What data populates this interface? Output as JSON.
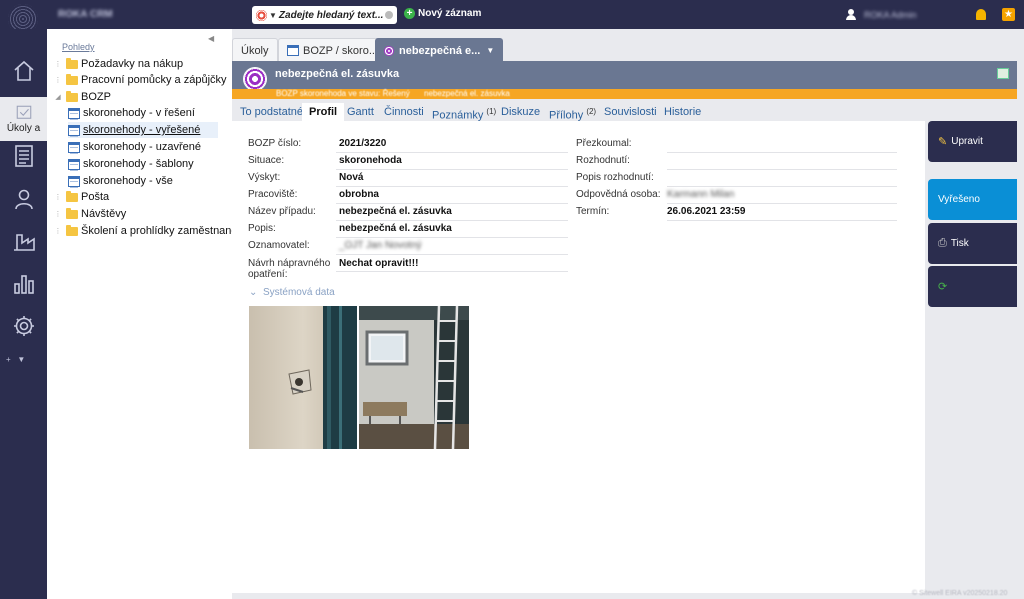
{
  "app": {
    "title": "ROKA CRM"
  },
  "topbar": {
    "search_placeholder": "Zadejte hledaný text...",
    "new_record": "Nový záznam",
    "user_name": "ROKA Admin"
  },
  "rail": {
    "tasks_label": "Úkoly a",
    "icons": [
      "home-icon",
      "tasks-icon",
      "document-icon",
      "user-icon",
      "factory-icon",
      "chart-icon",
      "gear-icon"
    ]
  },
  "tree": {
    "heading": "Pohledy",
    "items": [
      {
        "label": "Požadavky na nákup"
      },
      {
        "label": "Pracovní pomůcky a zápůjčky"
      },
      {
        "label": "BOZP"
      },
      {
        "label": "skoronehody - v řešení"
      },
      {
        "label": "skoronehody - vyřešené"
      },
      {
        "label": "skoronehody - uzavřené"
      },
      {
        "label": "skoronehody - šablony"
      },
      {
        "label": "skoronehody - vše"
      },
      {
        "label": "Pošta"
      },
      {
        "label": "Návštěvy"
      },
      {
        "label": "Školení a prohlídky zaměstnanců"
      }
    ]
  },
  "tabs": [
    {
      "label": "Úkoly"
    },
    {
      "label": "BOZP / skoro..."
    },
    {
      "label": "nebezpečná e..."
    }
  ],
  "record": {
    "title": "nebezpečná el. zásuvka",
    "status_left": "BOZP skoronehoda ve stavu: Řešený",
    "status_right": "nebezpečná el. zásuvka"
  },
  "subtabs": [
    {
      "label": "To podstatné"
    },
    {
      "label": "Profil"
    },
    {
      "label": "Gantt"
    },
    {
      "label": "Činnosti"
    },
    {
      "label": "Poznámky",
      "count": "(1)"
    },
    {
      "label": "Diskuze"
    },
    {
      "label": "Přílohy",
      "count": "(2)"
    },
    {
      "label": "Souvislosti"
    },
    {
      "label": "Historie"
    }
  ],
  "fields_left": [
    {
      "label": "BOZP číslo:",
      "value": "2021/3220"
    },
    {
      "label": "Situace:",
      "value": "skoronehoda"
    },
    {
      "label": "Výskyt:",
      "value": "Nová"
    },
    {
      "label": "Pracoviště:",
      "value": "obrobna"
    },
    {
      "label": "Název případu:",
      "value": "nebezpečná el. zásuvka"
    },
    {
      "label": "Popis:",
      "value": "nebezpečná el. zásuvka"
    },
    {
      "label": "Oznamovatel:",
      "value": "_OJT Jan Novotný"
    },
    {
      "label_line1": "Návrh nápravného",
      "label_line2": "opatření:",
      "value": "Nechat opravit!!!"
    }
  ],
  "fields_right": [
    {
      "label": "Přezkoumal:",
      "value": ""
    },
    {
      "label": "Rozhodnutí:",
      "value": ""
    },
    {
      "label": "Popis rozhodnutí:",
      "value": ""
    },
    {
      "label": "Odpovědná osoba:",
      "value": "Karmann Milan"
    },
    {
      "label": "Termín:",
      "value": "26.06.2021 23:59"
    }
  ],
  "sysdata_label": "Systémová data",
  "actions": {
    "edit": "Upravit",
    "resolved": "Vyřešeno",
    "print": "Tisk"
  },
  "footer": "© Sitewell EIRA v20250218.20"
}
